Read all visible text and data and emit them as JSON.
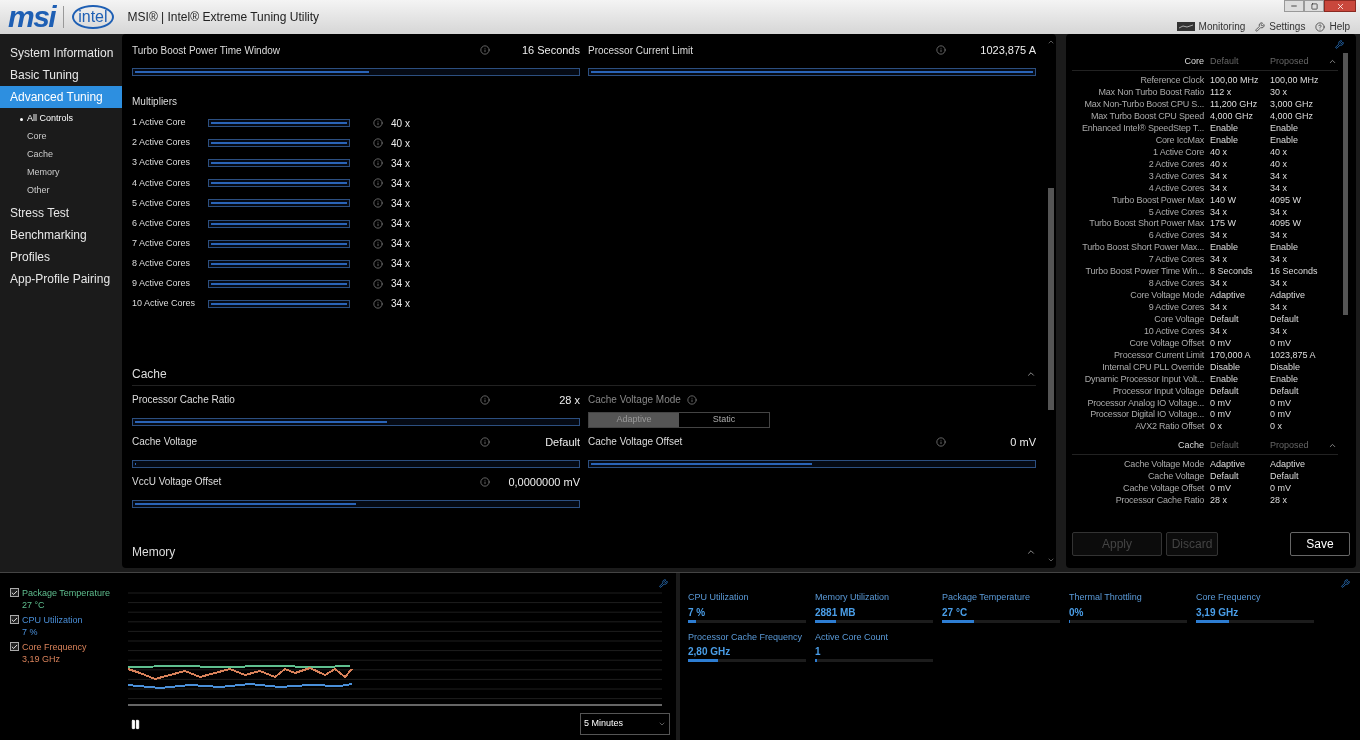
{
  "title_bar": {
    "logo": "msi",
    "partner_logo": "intel",
    "title": "MSI® | Intel® Extreme Tuning Utility",
    "links": [
      "Monitoring",
      "Settings",
      "Help"
    ]
  },
  "sidebar": {
    "items": [
      {
        "label": "System Information",
        "selected": false
      },
      {
        "label": "Basic Tuning",
        "selected": false
      },
      {
        "label": "Advanced Tuning",
        "selected": true,
        "children": [
          {
            "label": "All Controls",
            "selected": true
          },
          {
            "label": "Core",
            "selected": false
          },
          {
            "label": "Cache",
            "selected": false
          },
          {
            "label": "Memory",
            "selected": false
          },
          {
            "label": "Other",
            "selected": false
          }
        ]
      },
      {
        "label": "Stress Test",
        "selected": false
      },
      {
        "label": "Benchmarking",
        "selected": false
      },
      {
        "label": "Profiles",
        "selected": false
      },
      {
        "label": "App-Profile Pairing",
        "selected": false
      }
    ]
  },
  "top_controls": [
    {
      "label": "Turbo Boost Power Time Window",
      "value": "16 Seconds",
      "level": 0.53
    },
    {
      "label": "Processor Current Limit",
      "value": "1023,875 A",
      "level": 1.0
    }
  ],
  "multipliers": {
    "title": "Multipliers",
    "rows": [
      {
        "label": "1 Active Core",
        "value": "40 x",
        "level": 1.0
      },
      {
        "label": "2 Active Cores",
        "value": "40 x",
        "level": 1.0
      },
      {
        "label": "3 Active Cores",
        "value": "34 x",
        "level": 1.0
      },
      {
        "label": "4 Active Cores",
        "value": "34 x",
        "level": 1.0
      },
      {
        "label": "5 Active Cores",
        "value": "34 x",
        "level": 1.0
      },
      {
        "label": "6 Active Cores",
        "value": "34 x",
        "level": 1.0
      },
      {
        "label": "7 Active Cores",
        "value": "34 x",
        "level": 1.0
      },
      {
        "label": "8 Active Cores",
        "value": "34 x",
        "level": 1.0
      },
      {
        "label": "9 Active Cores",
        "value": "34 x",
        "level": 1.0
      },
      {
        "label": "10 Active Cores",
        "value": "34 x",
        "level": 1.0
      }
    ]
  },
  "cache": {
    "title": "Cache",
    "controls": [
      {
        "kind": "slider",
        "label": "Processor Cache Ratio",
        "value": "28 x",
        "level": 0.57
      },
      {
        "kind": "toggle",
        "label": "Cache Voltage Mode",
        "options": [
          {
            "label": "Adaptive",
            "selected": true
          },
          {
            "label": "Static",
            "selected": false
          }
        ]
      },
      {
        "kind": "slider",
        "label": "Cache Voltage",
        "value": "Default",
        "level": 0
      },
      {
        "kind": "slider",
        "label": "Cache Voltage Offset",
        "value": "0 mV",
        "level": 0.5
      },
      {
        "kind": "slider",
        "label": "VccU Voltage Offset",
        "value": "0,0000000 mV",
        "level": 0.5
      }
    ]
  },
  "memory": {
    "title": "Memory"
  },
  "summary": {
    "sections": [
      {
        "title": "Core",
        "default_heading": "Default",
        "proposed_heading": "Proposed",
        "rows": [
          {
            "label": "Reference Clock",
            "default": "100,00 MHz",
            "proposed": "100,00 MHz"
          },
          {
            "label": "Max Non Turbo Boost Ratio",
            "default": "112 x",
            "proposed": "30 x"
          },
          {
            "label": "Max Non-Turbo Boost CPU S...",
            "default": "11,200 GHz",
            "proposed": "3,000 GHz"
          },
          {
            "label": "Max Turbo Boost CPU Speed",
            "default": "4,000 GHz",
            "proposed": "4,000 GHz"
          },
          {
            "label": "Enhanced Intel® SpeedStep T...",
            "default": "Enable",
            "proposed": "Enable"
          },
          {
            "label": "Core IccMax",
            "default": "Enable",
            "proposed": "Enable"
          },
          {
            "label": "1 Active Core",
            "default": "40 x",
            "proposed": "40 x"
          },
          {
            "label": "2 Active Cores",
            "default": "40 x",
            "proposed": "40 x"
          },
          {
            "label": "3 Active Cores",
            "default": "34 x",
            "proposed": "34 x"
          },
          {
            "label": "4 Active Cores",
            "default": "34 x",
            "proposed": "34 x"
          },
          {
            "label": "Turbo Boost Power Max",
            "default": "140 W",
            "proposed": "4095 W"
          },
          {
            "label": "5 Active Cores",
            "default": "34 x",
            "proposed": "34 x"
          },
          {
            "label": "Turbo Boost Short Power Max",
            "default": "175 W",
            "proposed": "4095 W"
          },
          {
            "label": "6 Active Cores",
            "default": "34 x",
            "proposed": "34 x"
          },
          {
            "label": "Turbo Boost Short Power Max...",
            "default": "Enable",
            "proposed": "Enable"
          },
          {
            "label": "7 Active Cores",
            "default": "34 x",
            "proposed": "34 x"
          },
          {
            "label": "Turbo Boost Power Time Win...",
            "default": "8 Seconds",
            "proposed": "16 Seconds"
          },
          {
            "label": "8 Active Cores",
            "default": "34 x",
            "proposed": "34 x"
          },
          {
            "label": "Core Voltage Mode",
            "default": "Adaptive",
            "proposed": "Adaptive"
          },
          {
            "label": "9 Active Cores",
            "default": "34 x",
            "proposed": "34 x"
          },
          {
            "label": "Core Voltage",
            "default": "Default",
            "proposed": "Default"
          },
          {
            "label": "10 Active Cores",
            "default": "34 x",
            "proposed": "34 x"
          },
          {
            "label": "Core Voltage Offset",
            "default": "0 mV",
            "proposed": "0 mV"
          },
          {
            "label": "Processor Current Limit",
            "default": "170,000 A",
            "proposed": "1023,875 A"
          },
          {
            "label": "Internal CPU PLL Override",
            "default": "Disable",
            "proposed": "Disable"
          },
          {
            "label": "Dynamic Processor Input Volt...",
            "default": "Enable",
            "proposed": "Enable"
          },
          {
            "label": "Processor Input Voltage",
            "default": "Default",
            "proposed": "Default"
          },
          {
            "label": "Processor Analog IO Voltage...",
            "default": "0 mV",
            "proposed": "0 mV"
          },
          {
            "label": "Processor Digital IO Voltage...",
            "default": "0 mV",
            "proposed": "0 mV"
          },
          {
            "label": "AVX2 Ratio Offset",
            "default": "0 x",
            "proposed": "0 x"
          }
        ]
      },
      {
        "title": "Cache",
        "default_heading": "Default",
        "proposed_heading": "Proposed",
        "rows": [
          {
            "label": "Cache Voltage Mode",
            "default": "Adaptive",
            "proposed": "Adaptive"
          },
          {
            "label": "Cache Voltage",
            "default": "Default",
            "proposed": "Default"
          },
          {
            "label": "Cache Voltage Offset",
            "default": "0 mV",
            "proposed": "0 mV"
          },
          {
            "label": "Processor Cache Ratio",
            "default": "28 x",
            "proposed": "28 x"
          }
        ]
      }
    ],
    "buttons": [
      {
        "label": "Apply",
        "disabled": true
      },
      {
        "label": "Discard",
        "disabled": true
      },
      {
        "label": "Save",
        "disabled": false
      }
    ]
  },
  "monitor": {
    "series": [
      {
        "name": "Package Temperature",
        "value": "27 °C",
        "color": "#5fbf8f",
        "checked": true
      },
      {
        "name": "CPU Utilization",
        "value": "7 %",
        "color": "#4a8fd8",
        "checked": true
      },
      {
        "name": "Core Frequency",
        "value": "3,19 GHz",
        "color": "#d9825a",
        "checked": true
      }
    ],
    "range": "5 Minutes"
  },
  "metrics": [
    {
      "label": "CPU Utilization",
      "value": "7 %",
      "level": 0.07
    },
    {
      "label": "Memory Utilization",
      "value": "2881  MB",
      "level": 0.18
    },
    {
      "label": "Package Temperature",
      "value": "27 °C",
      "level": 0.27
    },
    {
      "label": "Thermal Throttling",
      "value": "0%",
      "level": 0
    },
    {
      "label": "Core Frequency",
      "value": "3,19 GHz",
      "level": 0.28
    },
    {
      "label": "Processor Cache Frequency",
      "value": "2,80 GHz",
      "level": 0.25
    },
    {
      "label": "Active Core Count",
      "value": "1",
      "level": 0.02
    }
  ]
}
